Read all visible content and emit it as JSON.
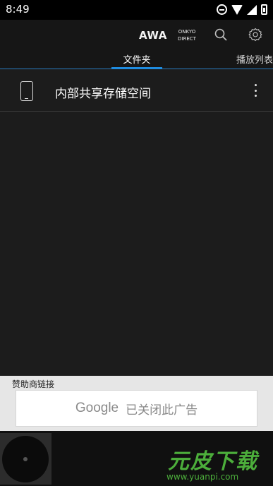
{
  "status_bar": {
    "time": "8:49"
  },
  "app_bar": {
    "awa_logo": "AWA",
    "onkyo_line1": "ONKYO",
    "onkyo_line2": "DIRECT",
    "tabs": [
      {
        "label": "文件夹",
        "active": true
      },
      {
        "label": "播放列表",
        "active": false
      }
    ],
    "accent_color": "#1f8ce0"
  },
  "storage_list": [
    {
      "label": "内部共享存储空间",
      "icon": "phone-icon"
    }
  ],
  "ad": {
    "label": "赞助商链接",
    "brand": "Google",
    "message": "已关闭此广告"
  },
  "watermark": {
    "logo": "元皮下载",
    "url": "www.yuanpi.com",
    "color": "#4cae3b"
  }
}
